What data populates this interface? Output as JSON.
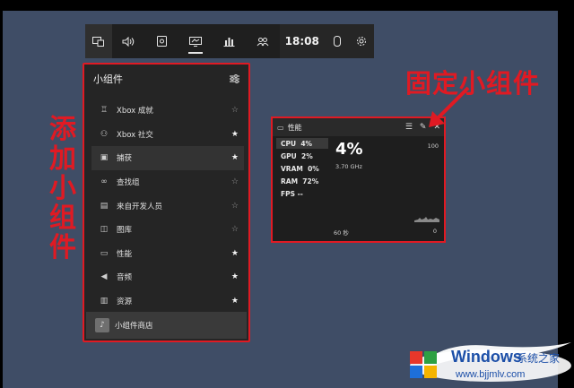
{
  "topbar": {
    "time": "18:08",
    "icons": [
      "widget-icon",
      "volume-icon",
      "capture-icon",
      "performance-icon",
      "resources-icon",
      "social-icon",
      "controller-icon",
      "settings-icon"
    ]
  },
  "widget_menu": {
    "title": "小组件",
    "items": [
      {
        "label": "Xbox 成就",
        "icon": "trophy-icon",
        "favorite": false
      },
      {
        "label": "Xbox 社交",
        "icon": "people-icon",
        "favorite": true
      },
      {
        "label": "捕获",
        "icon": "capture-icon",
        "favorite": true
      },
      {
        "label": "查找组",
        "icon": "binoculars-icon",
        "favorite": false
      },
      {
        "label": "来自开发人员",
        "icon": "dev-icon",
        "favorite": false
      },
      {
        "label": "图库",
        "icon": "gallery-icon",
        "favorite": false
      },
      {
        "label": "性能",
        "icon": "performance-icon",
        "favorite": true
      },
      {
        "label": "音频",
        "icon": "audio-icon",
        "favorite": true
      },
      {
        "label": "资源",
        "icon": "resources-icon",
        "favorite": true
      }
    ],
    "store_label": "小组件商店"
  },
  "performance": {
    "title": "性能",
    "rows": [
      {
        "name": "CPU",
        "value": "4%"
      },
      {
        "name": "GPU",
        "value": "2%"
      },
      {
        "name": "VRAM",
        "value": "0%"
      },
      {
        "name": "RAM",
        "value": "72%"
      },
      {
        "name": "FPS",
        "value": "--"
      }
    ],
    "big_value": "4%",
    "frequency": "3.70 GHz",
    "max": "100",
    "min": "0",
    "timespan": "60 秒"
  },
  "annotations": {
    "add_widget": [
      "添",
      "加",
      "小",
      "组",
      "件"
    ],
    "pin_widget": "固定小组件",
    "color": "#e01a23"
  },
  "watermark": {
    "title": "Windows",
    "brand": "系统之家",
    "url": "www.bjjmlv.com"
  }
}
